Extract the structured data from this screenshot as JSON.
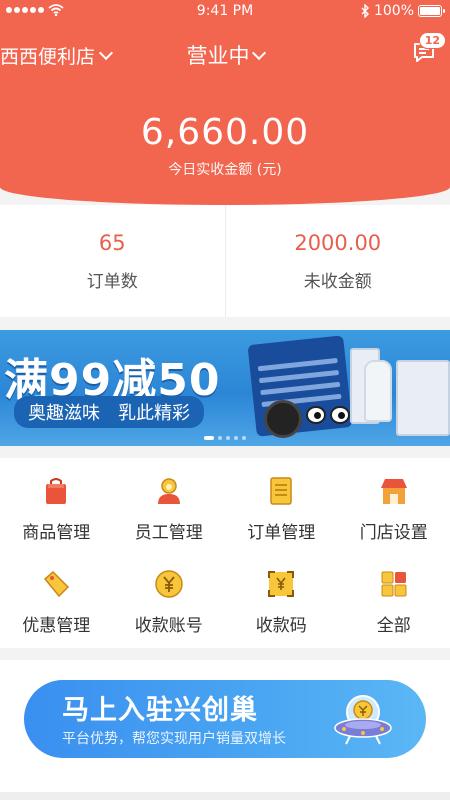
{
  "status_bar": {
    "time": "9:41 PM",
    "battery": "100%"
  },
  "header": {
    "store_name": "西西便利店",
    "business_status": "营业中",
    "message_count": "12",
    "revenue_amount": "6,660.00",
    "revenue_label": "今日实收金额 (元)"
  },
  "stats": [
    {
      "value": "65",
      "label": "订单数"
    },
    {
      "value": "2000.00",
      "label": "未收金额"
    }
  ],
  "banner": {
    "title": "满99减50",
    "subtitle": "奥趣滋味　乳此精彩",
    "slide_count": 5,
    "active_slide": 1
  },
  "grid": [
    {
      "label": "商品管理",
      "icon": "bag-icon"
    },
    {
      "label": "员工管理",
      "icon": "staff-icon"
    },
    {
      "label": "订单管理",
      "icon": "document-icon"
    },
    {
      "label": "门店设置",
      "icon": "store-icon"
    },
    {
      "label": "优惠管理",
      "icon": "tag-icon"
    },
    {
      "label": "收款账号",
      "icon": "yuan-coin-icon"
    },
    {
      "label": "收款码",
      "icon": "qr-yuan-icon"
    },
    {
      "label": "全部",
      "icon": "grid-icon"
    }
  ],
  "promo": {
    "title": "马上入驻兴创巢",
    "subtitle": "平台优势，帮您实现用户销量双增长"
  },
  "colors": {
    "brand": "#f2654f",
    "accent_text": "#e85f4c",
    "icon_orange": "#f08a2a",
    "icon_yellow": "#f7c63a"
  }
}
